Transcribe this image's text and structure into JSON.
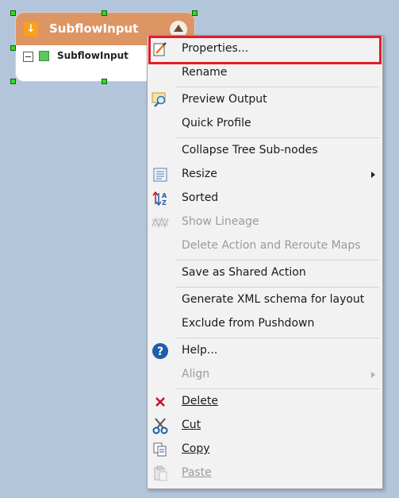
{
  "node": {
    "title": "SubflowInput",
    "field_label": "SubflowInput"
  },
  "menu": {
    "items": [
      {
        "label": "Properties...",
        "icon": "properties-icon",
        "enabled": true
      },
      {
        "label": "Rename",
        "icon": "",
        "enabled": true
      },
      {
        "label": "Preview Output",
        "icon": "preview-output-icon",
        "enabled": true
      },
      {
        "label": "Quick Profile",
        "icon": "",
        "enabled": true
      },
      {
        "label": "Collapse Tree Sub-nodes",
        "icon": "",
        "enabled": true
      },
      {
        "label": "Resize",
        "icon": "resize-icon",
        "enabled": true,
        "submenu": true
      },
      {
        "label": "Sorted",
        "icon": "sort-icon",
        "enabled": true
      },
      {
        "label": "Show Lineage",
        "icon": "lineage-icon",
        "enabled": false
      },
      {
        "label": "Delete Action and Reroute Maps",
        "icon": "",
        "enabled": false
      },
      {
        "label": "Save as Shared Action",
        "icon": "",
        "enabled": true
      },
      {
        "label": "Generate XML schema for layout",
        "icon": "",
        "enabled": true
      },
      {
        "label": "Exclude from Pushdown",
        "icon": "",
        "enabled": true
      },
      {
        "label": "Help...",
        "icon": "help-icon",
        "enabled": true
      },
      {
        "label": "Align",
        "icon": "",
        "enabled": false,
        "submenu": true
      },
      {
        "label": "Delete",
        "icon": "delete-icon",
        "enabled": true
      },
      {
        "label": "Cut",
        "icon": "cut-icon",
        "enabled": true
      },
      {
        "label": "Copy",
        "icon": "copy-icon",
        "enabled": true
      },
      {
        "label": "Paste",
        "icon": "paste-icon",
        "enabled": false
      }
    ]
  },
  "colors": {
    "canvas": "#b3c5da",
    "node_header": "#dd9563",
    "highlight": "#e01e2a",
    "delete_red": "#c8102e",
    "help_blue": "#1f5ea8"
  }
}
